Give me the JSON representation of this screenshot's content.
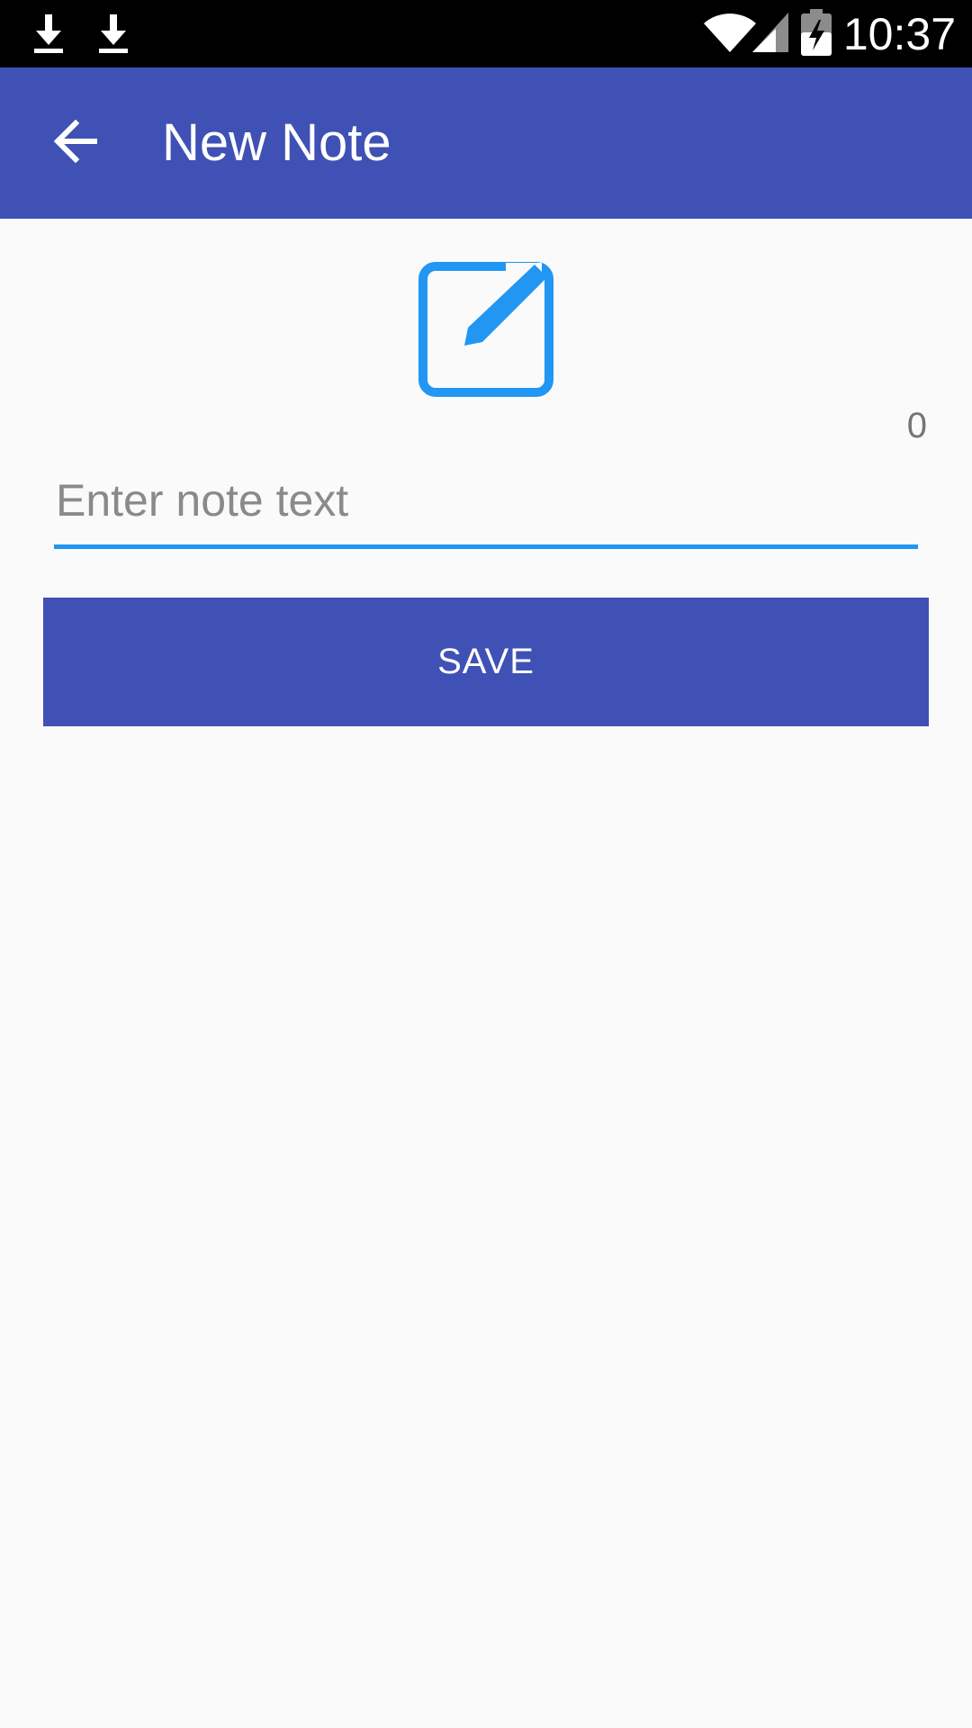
{
  "status_bar": {
    "time": "10:37",
    "icons": [
      "download-icon",
      "download-icon",
      "wifi-icon",
      "signal-icon",
      "battery-charging-icon"
    ]
  },
  "app_bar": {
    "title": "New Note",
    "back_icon": "arrow-back-icon"
  },
  "editor": {
    "icon": "edit-note-icon",
    "char_count": "0",
    "input_value": "",
    "input_placeholder": "Enter note text",
    "save_label": "SAVE"
  },
  "colors": {
    "primary": "#3f51b5",
    "accent": "#2196f3",
    "background": "#fafafa",
    "status_bar": "#000000"
  }
}
